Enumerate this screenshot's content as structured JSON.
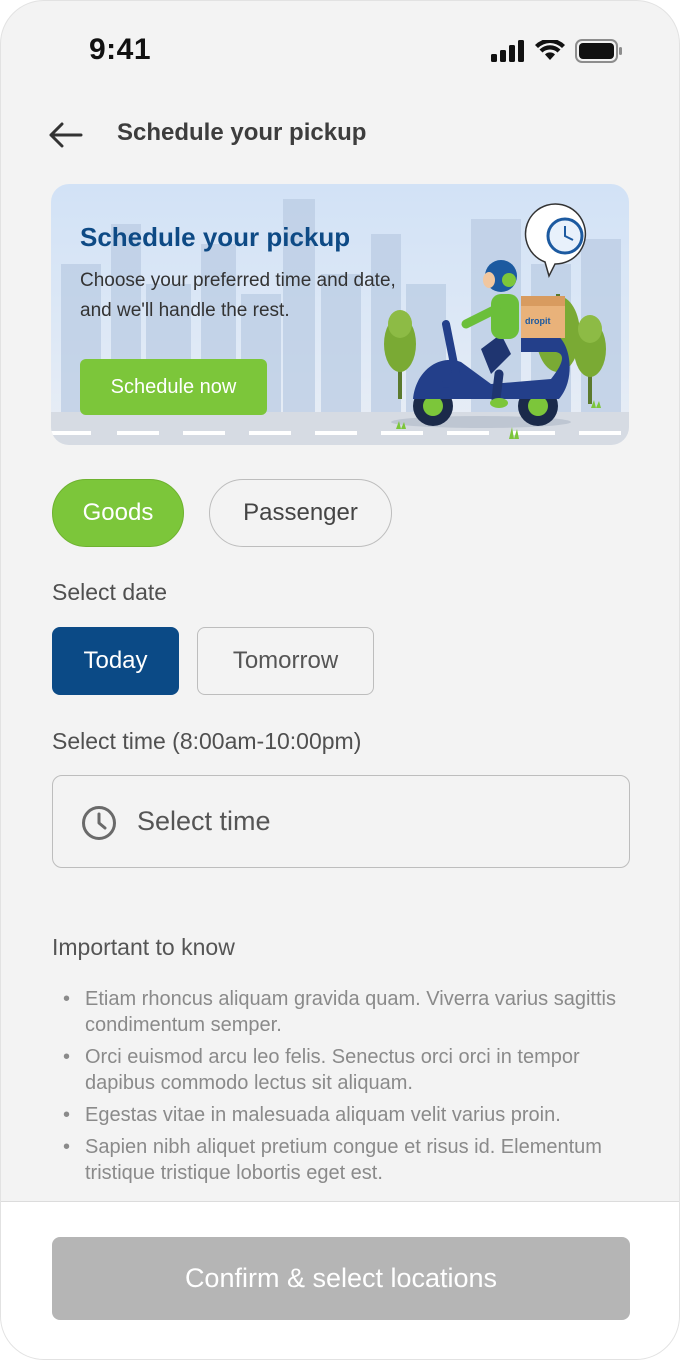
{
  "status_bar": {
    "time": "9:41",
    "icons": [
      "signal-icon",
      "wifi-icon",
      "battery-icon"
    ]
  },
  "header": {
    "back_icon": "back-arrow-icon",
    "title": "Schedule your pickup"
  },
  "banner": {
    "title": "Schedule your pickup",
    "description": "Choose your preferred time and date, and we'll handle the rest.",
    "button_label": "Schedule now",
    "illustration_brand": "dropit"
  },
  "service_type": {
    "options": [
      "Goods",
      "Passenger"
    ],
    "selected": "Goods"
  },
  "date": {
    "label": "Select date",
    "options": [
      "Today",
      "Tomorrow"
    ],
    "selected": "Today"
  },
  "time": {
    "label": "Select time (8:00am-10:00pm)",
    "placeholder": "Select time",
    "icon": "clock-icon"
  },
  "info": {
    "title": "Important to know",
    "items": [
      "Etiam rhoncus aliquam gravida quam. Viverra varius sagittis condimentum semper.",
      "Orci euismod arcu leo felis. Senectus orci orci in tempor dapibus commodo lectus sit aliquam.",
      "Egestas vitae in malesuada aliquam velit varius proin.",
      "Sapien nibh aliquet pretium congue et risus id. Elementum tristique tristique lobortis eget est."
    ]
  },
  "footer": {
    "confirm_label": "Confirm & select locations"
  },
  "colors": {
    "accent_green": "#7cc63a",
    "primary_blue": "#0b4a86",
    "disabled_gray": "#b5b5b5",
    "background": "#f3f3f3"
  }
}
